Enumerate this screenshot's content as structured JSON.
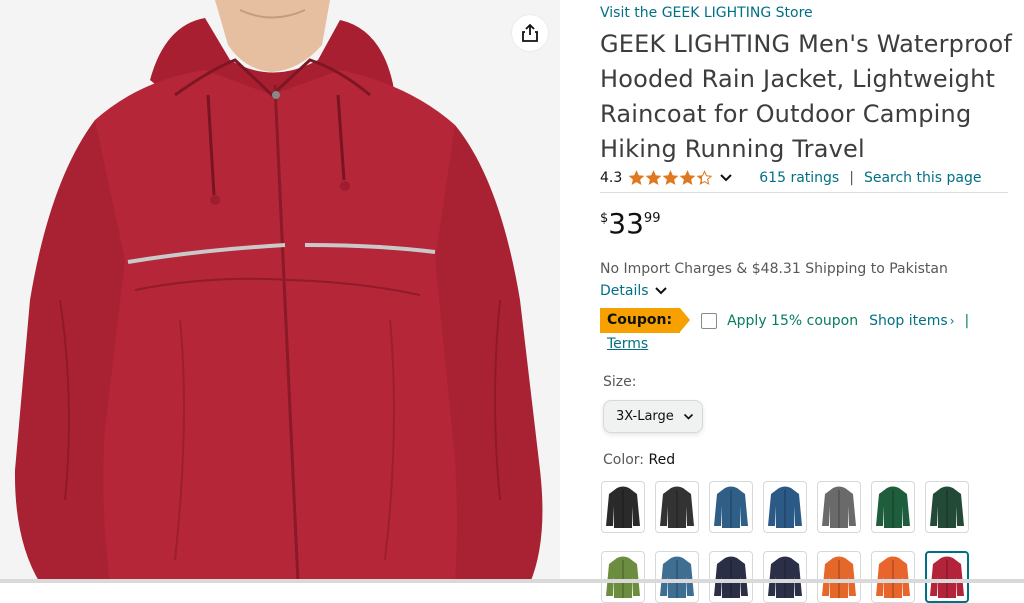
{
  "product": {
    "store_link": "Visit the GEEK LIGHTING Store",
    "title": "GEEK LIGHTING Men's Waterproof Hooded Rain Jacket, Lightweight Raincoat for Outdoor Camping Hiking Running Travel",
    "rating_value": "4.3",
    "rating_stars": 4.3,
    "ratings_count": "615 ratings",
    "separator": "|",
    "search_page": "Search this page",
    "price_symbol": "$",
    "price_whole": "33",
    "price_fraction": "99",
    "shipping": "No Import Charges & $48.31 Shipping to Pakistan",
    "details": "Details",
    "coupon_badge": "Coupon:",
    "apply_coupon": "Apply 15% coupon",
    "shop_items": "Shop items",
    "shop_chevron": "›",
    "coupon_pipe": "|",
    "terms": "Terms",
    "size_label": "Size:",
    "size_selected": "3X-Large",
    "color_label": "Color:",
    "color_selected": "Red"
  },
  "swatch_colors": [
    "#2a2a2a",
    "#333333",
    "#2f5f86",
    "#2c5a87",
    "#6a6a6a",
    "#1f5e3c",
    "#234a36",
    "#6c8d3f",
    "#3f6e93",
    "#2b2f45",
    "#2b3048",
    "#e5672a",
    "#e8652b",
    "#b3233a"
  ],
  "jacket_color": "#b52638",
  "accent_color": "#007185",
  "coupon_color": "#f7a100",
  "star_color": "#de7921"
}
